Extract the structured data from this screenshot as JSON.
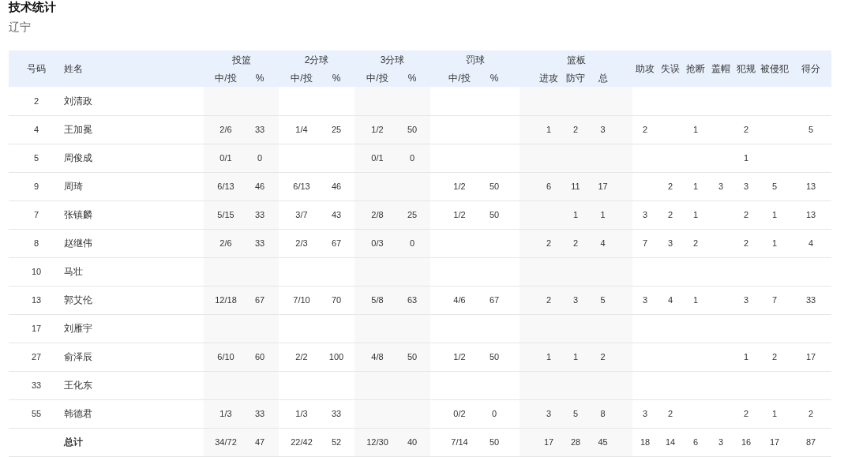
{
  "title": "技术统计",
  "team": "辽宁",
  "table": {
    "columns": [
      {
        "label": "号码"
      },
      {
        "label": "姓名"
      },
      {
        "label": "投篮",
        "sub": [
          "中/投",
          "%"
        ]
      },
      {
        "label": "2分球",
        "sub": [
          "中/投",
          "%"
        ]
      },
      {
        "label": "3分球",
        "sub": [
          "中/投",
          "%"
        ]
      },
      {
        "label": "罚球",
        "sub": [
          "中/投",
          "%"
        ]
      },
      {
        "label": "篮板",
        "sub": [
          "进攻",
          "防守",
          "总"
        ]
      },
      {
        "label": "助攻"
      },
      {
        "label": "失误"
      },
      {
        "label": "抢断"
      },
      {
        "label": "盖帽"
      },
      {
        "label": "犯规"
      },
      {
        "label": "被侵犯"
      },
      {
        "label": "得分"
      }
    ],
    "rows": [
      {
        "kind": "player",
        "number": "2",
        "name": "刘清政"
      },
      {
        "kind": "player",
        "number": "4",
        "name": "王加冕",
        "fg": "2/6",
        "fg_pct": "33",
        "two": "1/4",
        "two_pct": "25",
        "three": "1/2",
        "three_pct": "50",
        "oreb": "1",
        "dreb": "2",
        "reb": "3",
        "ast": "2",
        "stl": "1",
        "pf": "2",
        "pts": "5"
      },
      {
        "kind": "player",
        "number": "5",
        "name": "周俊成",
        "fg": "0/1",
        "fg_pct": "0",
        "three": "0/1",
        "three_pct": "0",
        "pf": "1"
      },
      {
        "kind": "player",
        "number": "9",
        "name": "周琦",
        "fg": "6/13",
        "fg_pct": "46",
        "two": "6/13",
        "two_pct": "46",
        "ft": "1/2",
        "ft_pct": "50",
        "oreb": "6",
        "dreb": "11",
        "reb": "17",
        "tov": "2",
        "stl": "1",
        "blk": "3",
        "pf": "3",
        "fd": "5",
        "pts": "13"
      },
      {
        "kind": "player",
        "number": "7",
        "name": "张镇麟",
        "fg": "5/15",
        "fg_pct": "33",
        "two": "3/7",
        "two_pct": "43",
        "three": "2/8",
        "three_pct": "25",
        "ft": "1/2",
        "ft_pct": "50",
        "dreb": "1",
        "reb": "1",
        "ast": "3",
        "tov": "2",
        "stl": "1",
        "pf": "2",
        "fd": "1",
        "pts": "13"
      },
      {
        "kind": "player",
        "number": "8",
        "name": "赵继伟",
        "fg": "2/6",
        "fg_pct": "33",
        "two": "2/3",
        "two_pct": "67",
        "three": "0/3",
        "three_pct": "0",
        "oreb": "2",
        "dreb": "2",
        "reb": "4",
        "ast": "7",
        "tov": "3",
        "stl": "2",
        "pf": "2",
        "fd": "1",
        "pts": "4"
      },
      {
        "kind": "player",
        "number": "10",
        "name": "马壮"
      },
      {
        "kind": "player",
        "number": "13",
        "name": "郭艾伦",
        "fg": "12/18",
        "fg_pct": "67",
        "two": "7/10",
        "two_pct": "70",
        "three": "5/8",
        "three_pct": "63",
        "ft": "4/6",
        "ft_pct": "67",
        "oreb": "2",
        "dreb": "3",
        "reb": "5",
        "ast": "3",
        "tov": "4",
        "stl": "1",
        "pf": "3",
        "fd": "7",
        "pts": "33"
      },
      {
        "kind": "player",
        "number": "17",
        "name": "刘雁宇"
      },
      {
        "kind": "player",
        "number": "27",
        "name": "俞泽辰",
        "fg": "6/10",
        "fg_pct": "60",
        "two": "2/2",
        "two_pct": "100",
        "three": "4/8",
        "three_pct": "50",
        "ft": "1/2",
        "ft_pct": "50",
        "oreb": "1",
        "dreb": "1",
        "reb": "2",
        "pf": "1",
        "fd": "2",
        "pts": "17"
      },
      {
        "kind": "player",
        "number": "33",
        "name": "王化东"
      },
      {
        "kind": "player",
        "number": "55",
        "name": "韩德君",
        "fg": "1/3",
        "fg_pct": "33",
        "two": "1/3",
        "two_pct": "33",
        "ft": "0/2",
        "ft_pct": "0",
        "oreb": "3",
        "dreb": "5",
        "reb": "8",
        "ast": "3",
        "tov": "2",
        "pf": "2",
        "fd": "1",
        "pts": "2"
      },
      {
        "kind": "total",
        "name": "总计",
        "fg": "34/72",
        "fg_pct": "47",
        "two": "22/42",
        "two_pct": "52",
        "three": "12/30",
        "three_pct": "40",
        "ft": "7/14",
        "ft_pct": "50",
        "oreb": "17",
        "dreb": "28",
        "reb": "45",
        "ast": "18",
        "tov": "14",
        "stl": "6",
        "blk": "3",
        "pf": "16",
        "fd": "17",
        "pts": "87"
      }
    ]
  }
}
